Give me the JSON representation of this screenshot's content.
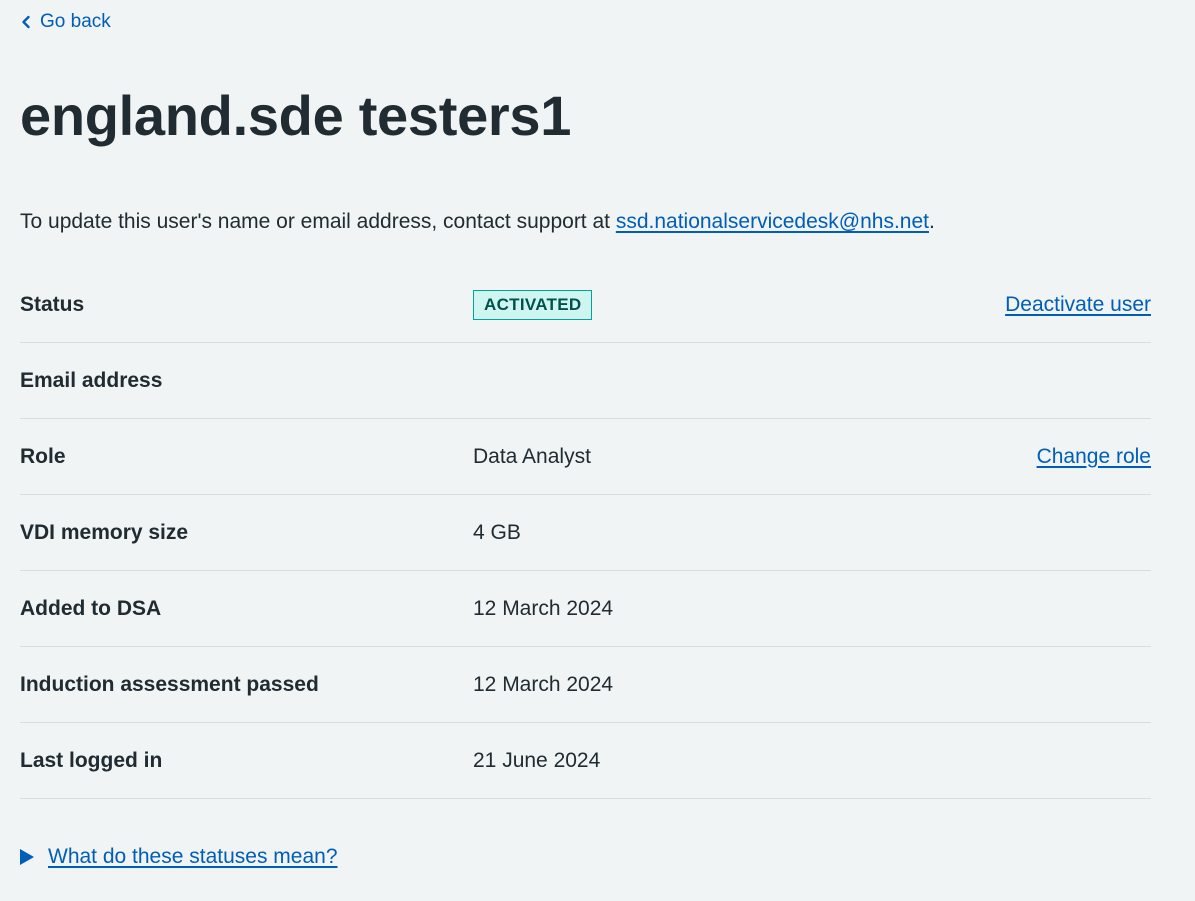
{
  "nav": {
    "back_label": "Go back"
  },
  "page": {
    "title": "england.sde testers1",
    "intro_text": "To update this user's name or email address, contact support at ",
    "support_email": "ssd.nationalservicedesk@nhs.net",
    "intro_suffix": "."
  },
  "summary": {
    "rows": [
      {
        "key": "Status",
        "value": "ACTIVATED",
        "action": "Deactivate user"
      },
      {
        "key": "Email address",
        "value": "",
        "action": ""
      },
      {
        "key": "Role",
        "value": "Data Analyst",
        "action": "Change role"
      },
      {
        "key": "VDI memory size",
        "value": "4 GB",
        "action": ""
      },
      {
        "key": "Added to DSA",
        "value": "12 March 2024",
        "action": ""
      },
      {
        "key": "Induction assessment passed",
        "value": "12 March 2024",
        "action": ""
      },
      {
        "key": "Last logged in",
        "value": "21 June 2024",
        "action": ""
      }
    ]
  },
  "details": {
    "summary_label": "What do these statuses mean?"
  },
  "colors": {
    "link": "#005eb8",
    "text": "#212b32",
    "background": "#f0f4f5",
    "tag_border": "#00a499",
    "tag_background": "#cff5f1",
    "tag_text": "#00524d"
  },
  "icons": {
    "back": "chevron-left-icon",
    "details": "triangle-right-icon"
  }
}
